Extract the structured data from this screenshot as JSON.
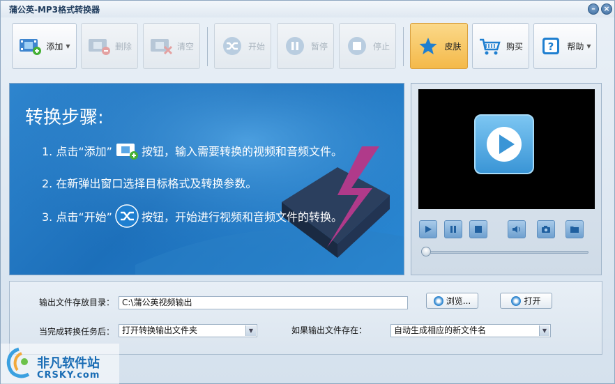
{
  "window": {
    "title": "蒲公英-MP3格式转换器"
  },
  "toolbar": {
    "add": "添加",
    "delete": "删除",
    "clear": "清空",
    "start": "开始",
    "pause": "暂停",
    "stop": "停止",
    "skin": "皮肤",
    "buy": "购买",
    "help": "帮助"
  },
  "steps": {
    "title": "转换步骤:",
    "step1_a": "1. 点击“添加”",
    "step1_b": "按钮，输入需要转换的视频和音频文件。",
    "step2": "2. 在新弹出窗口选择目标格式及转换参数。",
    "step3_a": "3. 点击“开始”",
    "step3_b": "按钮，开始进行视频和音频文件的转换。"
  },
  "player": {
    "controls": [
      "play-icon",
      "pause-icon",
      "stop-icon",
      "volume-icon",
      "camera-icon",
      "folder-icon"
    ]
  },
  "settings": {
    "output_dir_label": "输出文件存放目录：",
    "output_dir_value": "C:\\蒲公英视频输出",
    "browse": "浏览...",
    "open": "打开",
    "after_task_label": "当完成转换任务后：",
    "after_task_value": "打开转换输出文件夹",
    "if_exists_label": "如果输出文件存在：",
    "if_exists_value": "自动生成相应的新文件名"
  },
  "watermark": {
    "site_cn": "非凡软件站",
    "site_en": "CRSKY.com"
  },
  "colors": {
    "accent": "#2a8ad6",
    "active_button": "#f4b94a"
  }
}
